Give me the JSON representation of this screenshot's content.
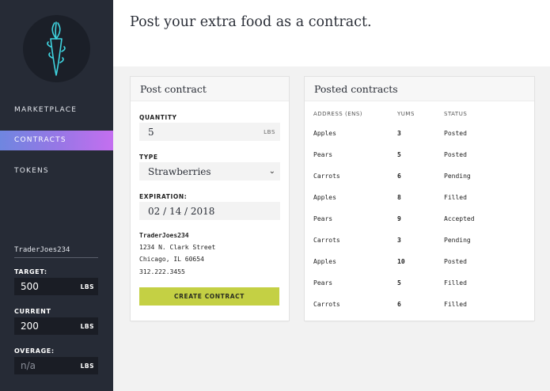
{
  "sidebar": {
    "nav": [
      {
        "label": "MARKETPLACE",
        "active": false
      },
      {
        "label": "CONTRACTS",
        "active": true
      },
      {
        "label": "TOKENS",
        "active": false
      }
    ],
    "username": "TraderJoes234",
    "stats": [
      {
        "label": "TARGET:",
        "value": "500",
        "unit": "LBS"
      },
      {
        "label": "CURRENT",
        "value": "200",
        "unit": "LBS"
      },
      {
        "label": "OVERAGE:",
        "placeholder": "n/a",
        "unit": "LBS"
      }
    ]
  },
  "header": {
    "title": "Post your extra food as a contract."
  },
  "post_contract": {
    "title": "Post contract",
    "quantity": {
      "label": "QUANTITY",
      "value": "5",
      "unit": "LBS"
    },
    "type": {
      "label": "TYPE",
      "value": "Strawberries"
    },
    "expiration": {
      "label": "EXPIRATION:",
      "value": "02 / 14 / 2018"
    },
    "address": {
      "name": "TraderJoes234",
      "street": "1234 N. Clark Street",
      "city": "Chicago, IL 60654",
      "phone": "312.222.3455"
    },
    "submit_label": "CREATE CONTRACT"
  },
  "posted_contracts": {
    "title": "Posted contracts",
    "columns": [
      "ADDRESS (ENS)",
      "YUMS",
      "STATUS"
    ],
    "rows": [
      {
        "address": "Apples",
        "yums": "3",
        "status": "Posted"
      },
      {
        "address": "Pears",
        "yums": "5",
        "status": "Posted"
      },
      {
        "address": "Carrots",
        "yums": "6",
        "status": "Pending"
      },
      {
        "address": "Apples",
        "yums": "8",
        "status": "Filled"
      },
      {
        "address": "Pears",
        "yums": "9",
        "status": "Accepted"
      },
      {
        "address": "Carrots",
        "yums": "3",
        "status": "Pending"
      },
      {
        "address": "Apples",
        "yums": "10",
        "status": "Posted"
      },
      {
        "address": "Pears",
        "yums": "5",
        "status": "Filled"
      },
      {
        "address": "Carrots",
        "yums": "6",
        "status": "Filled"
      }
    ]
  },
  "colors": {
    "sidebar_bg": "#262b36",
    "active_gradient_start": "#6f86e0",
    "active_gradient_end": "#c46ff0",
    "logo_accent": "#3fd4e0",
    "button_bg": "#c4d044"
  },
  "icons": {
    "logo": "carrot-logo-icon",
    "type_dropdown": "chevron-down-icon"
  }
}
